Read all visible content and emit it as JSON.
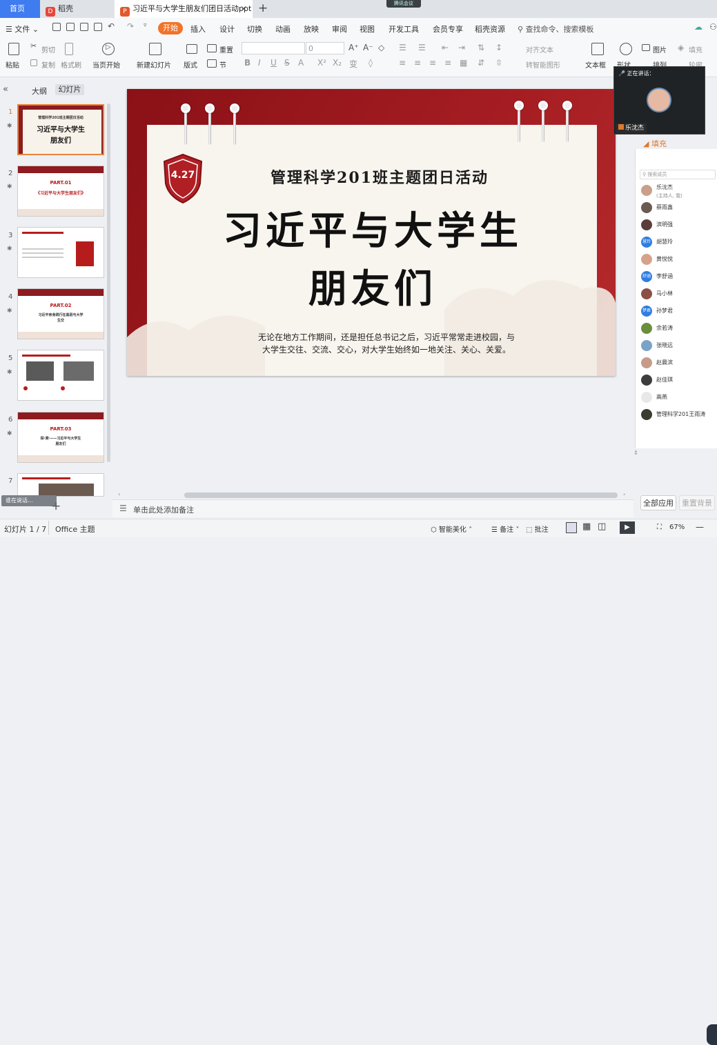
{
  "tabs": {
    "home": "首页",
    "docer": "稻壳",
    "document": "习近平与大学生朋友们团日活动ppt",
    "close": "✕",
    "add": "+"
  },
  "meeting_badge": "腾讯会议",
  "menu": {
    "file": "文件",
    "items": [
      "开始",
      "插入",
      "设计",
      "切换",
      "动画",
      "放映",
      "审阅",
      "视图",
      "开发工具",
      "会员专享",
      "稻壳资源"
    ],
    "search": "查找命令、搜索模板"
  },
  "ribbon": {
    "paste": "粘贴",
    "cut": "剪切",
    "copy": "复制",
    "format_painter": "格式刷",
    "play_from_current": "当页开始",
    "new_slide": "新建幻灯片",
    "layout": "版式",
    "section": "节",
    "reset": "重置",
    "font_size": "0",
    "align_text": "对齐文本",
    "smart_graphic": "转智能图形",
    "textbox": "文本框",
    "shape": "形状",
    "arrange": "排列",
    "picture": "图片",
    "fill": "填充",
    "outline": "轮廓"
  },
  "left_panel": {
    "tab_outline": "大纲",
    "tab_slides": "幻灯片",
    "slides": [
      {
        "num": "1",
        "t1": "管理科学201班主题团日活动",
        "t2": "习近平与大学生",
        "t3": "朋友们"
      },
      {
        "num": "2",
        "t1": "PART.01",
        "t2": "《习近平与大学生朋友们》",
        "t3": ""
      },
      {
        "num": "3",
        "t1": "",
        "t2": "",
        "t3": ""
      },
      {
        "num": "4",
        "t1": "PART.02",
        "t2": "习近平亲身践行在基层与大学",
        "t3": "生交"
      },
      {
        "num": "5",
        "t1": "",
        "t2": "",
        "t3": ""
      },
      {
        "num": "6",
        "t1": "PART.03",
        "t2": "探·溯·——习近平与大学生",
        "t3": "朋友们"
      },
      {
        "num": "7",
        "t1": "",
        "t2": "",
        "t3": ""
      }
    ],
    "talking": "谁在说话...",
    "add": "+"
  },
  "slide": {
    "badge": "4.27",
    "subtitle": "管理科学201班主题团日活动",
    "title_line1": "习近平与大学生",
    "title_line2": "朋友们",
    "body_line1": "无论在地方工作期间，还是担任总书记之后，习近平常常走进校园，与",
    "body_line2": "大学生交往、交流、交心，对大学生始终如一地关注、关心、关爱。"
  },
  "notes_placeholder": "单击此处添加备注",
  "video": {
    "speaking_label": "正在讲话：",
    "speaker": "乐沈杰"
  },
  "right_panel": {
    "fill_label": "填充",
    "member_search": "搜索成员",
    "members": [
      {
        "name": "乐沈杰",
        "sub": "(主持人, 我)",
        "color": "#c9a08a",
        "initial": ""
      },
      {
        "name": "蔡雨鑫",
        "sub": "",
        "color": "#6b5a52",
        "initial": ""
      },
      {
        "name": "滨明强",
        "sub": "",
        "color": "#5b3d3a",
        "initial": ""
      },
      {
        "name": "胡慧玲",
        "sub": "",
        "color": "#2f7de1",
        "initial": "慧玲"
      },
      {
        "name": "黄悦悦",
        "sub": "",
        "color": "#d7a28a",
        "initial": ""
      },
      {
        "name": "李舒涵",
        "sub": "",
        "color": "#2f7de1",
        "initial": "舒涵"
      },
      {
        "name": "马小林",
        "sub": "",
        "color": "#8a4f45",
        "initial": ""
      },
      {
        "name": "孙梦君",
        "sub": "",
        "color": "#2f7de1",
        "initial": "梦君"
      },
      {
        "name": "余若涛",
        "sub": "",
        "color": "#6a8f3b",
        "initial": ""
      },
      {
        "name": "张晓远",
        "sub": "",
        "color": "#7aa3c7",
        "initial": ""
      },
      {
        "name": "赵晨滨",
        "sub": "",
        "color": "#c79b8a",
        "initial": ""
      },
      {
        "name": "赵佳琪",
        "sub": "",
        "color": "#3d3d3d",
        "initial": ""
      },
      {
        "name": "高燕",
        "sub": "",
        "color": "#e8e8e8",
        "initial": ""
      },
      {
        "name": "管理科学201王雨涛",
        "sub": "",
        "color": "#3b3b30",
        "initial": ""
      }
    ],
    "apply_all": "全部应用",
    "reset_bg": "重置背景"
  },
  "status": {
    "slide_count": "幻灯片 1 / 7",
    "theme": "Office 主题",
    "beautify": "智能美化",
    "notes": "备注",
    "comment": "批注",
    "zoom": "67%"
  }
}
